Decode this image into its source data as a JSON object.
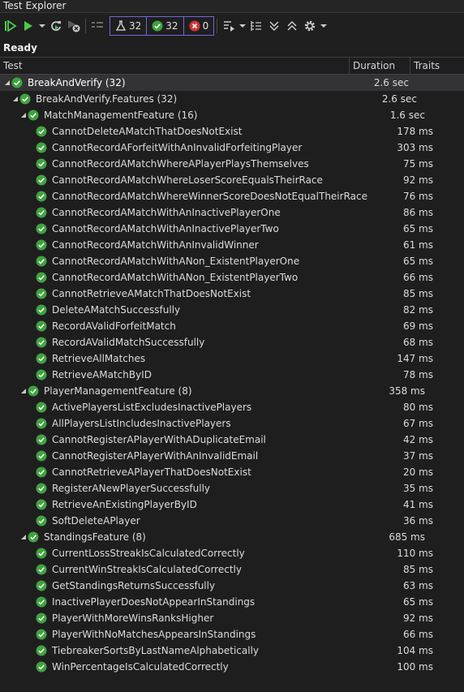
{
  "window": {
    "title": "Test Explorer"
  },
  "toolbar": {
    "counts": {
      "total": "32",
      "passed": "32",
      "failed": "0"
    },
    "colors": {
      "pass": "#3fa33f",
      "fail": "#d13438",
      "run": "#4ec94e",
      "badge_border": "#7367d8"
    }
  },
  "status": "Ready",
  "columns": {
    "test": "Test",
    "duration": "Duration",
    "traits": "Traits"
  },
  "rows": [
    {
      "label": "BreakAndVerify (32)",
      "duration": "2.6 sec",
      "level": 0,
      "expandable": true,
      "selected": true
    },
    {
      "label": "BreakAndVerify.Features (32)",
      "duration": "2.6 sec",
      "level": 1,
      "expandable": true
    },
    {
      "label": "MatchManagementFeature (16)",
      "duration": "1.6 sec",
      "level": 2,
      "expandable": true
    },
    {
      "label": "CannotDeleteAMatchThatDoesNotExist",
      "duration": "178 ms",
      "level": 3
    },
    {
      "label": "CannotRecordAForfeitWithAnInvalidForfeitingPlayer",
      "duration": "303 ms",
      "level": 3
    },
    {
      "label": "CannotRecordAMatchWhereAPlayerPlaysThemselves",
      "duration": "75 ms",
      "level": 3
    },
    {
      "label": "CannotRecordAMatchWhereLoserScoreEqualsTheirRace",
      "duration": "92 ms",
      "level": 3
    },
    {
      "label": "CannotRecordAMatchWhereWinnerScoreDoesNotEqualTheirRace",
      "duration": "76 ms",
      "level": 3
    },
    {
      "label": "CannotRecordAMatchWithAnInactivePlayerOne",
      "duration": "86 ms",
      "level": 3
    },
    {
      "label": "CannotRecordAMatchWithAnInactivePlayerTwo",
      "duration": "65 ms",
      "level": 3
    },
    {
      "label": "CannotRecordAMatchWithAnInvalidWinner",
      "duration": "61 ms",
      "level": 3
    },
    {
      "label": "CannotRecordAMatchWithANon_ExistentPlayerOne",
      "duration": "65 ms",
      "level": 3
    },
    {
      "label": "CannotRecordAMatchWithANon_ExistentPlayerTwo",
      "duration": "66 ms",
      "level": 3
    },
    {
      "label": "CannotRetrieveAMatchThatDoesNotExist",
      "duration": "85 ms",
      "level": 3
    },
    {
      "label": "DeleteAMatchSuccessfully",
      "duration": "82 ms",
      "level": 3
    },
    {
      "label": "RecordAValidForfeitMatch",
      "duration": "69 ms",
      "level": 3
    },
    {
      "label": "RecordAValidMatchSuccessfully",
      "duration": "68 ms",
      "level": 3
    },
    {
      "label": "RetrieveAllMatches",
      "duration": "147 ms",
      "level": 3
    },
    {
      "label": "RetrieveAMatchByID",
      "duration": "78 ms",
      "level": 3
    },
    {
      "label": "PlayerManagementFeature (8)",
      "duration": "358 ms",
      "level": 2,
      "expandable": true
    },
    {
      "label": "ActivePlayersListExcludesInactivePlayers",
      "duration": "80 ms",
      "level": 3
    },
    {
      "label": "AllPlayersListIncludesInactivePlayers",
      "duration": "67 ms",
      "level": 3
    },
    {
      "label": "CannotRegisterAPlayerWithADuplicateEmail",
      "duration": "42 ms",
      "level": 3
    },
    {
      "label": "CannotRegisterAPlayerWithAnInvalidEmail",
      "duration": "37 ms",
      "level": 3
    },
    {
      "label": "CannotRetrieveAPlayerThatDoesNotExist",
      "duration": "20 ms",
      "level": 3
    },
    {
      "label": "RegisterANewPlayerSuccessfully",
      "duration": "35 ms",
      "level": 3
    },
    {
      "label": "RetrieveAnExistingPlayerByID",
      "duration": "41 ms",
      "level": 3
    },
    {
      "label": "SoftDeleteAPlayer",
      "duration": "36 ms",
      "level": 3
    },
    {
      "label": "StandingsFeature (8)",
      "duration": "685 ms",
      "level": 2,
      "expandable": true
    },
    {
      "label": "CurrentLossStreakIsCalculatedCorrectly",
      "duration": "110 ms",
      "level": 3
    },
    {
      "label": "CurrentWinStreakIsCalculatedCorrectly",
      "duration": "85 ms",
      "level": 3
    },
    {
      "label": "GetStandingsReturnsSuccessfully",
      "duration": "63 ms",
      "level": 3
    },
    {
      "label": "InactivePlayerDoesNotAppearInStandings",
      "duration": "65 ms",
      "level": 3
    },
    {
      "label": "PlayerWithMoreWinsRanksHigher",
      "duration": "92 ms",
      "level": 3
    },
    {
      "label": "PlayerWithNoMatchesAppearsInStandings",
      "duration": "66 ms",
      "level": 3
    },
    {
      "label": "TiebreakerSortsByLastNameAlphabetically",
      "duration": "104 ms",
      "level": 3
    },
    {
      "label": "WinPercentageIsCalculatedCorrectly",
      "duration": "100 ms",
      "level": 3
    }
  ]
}
